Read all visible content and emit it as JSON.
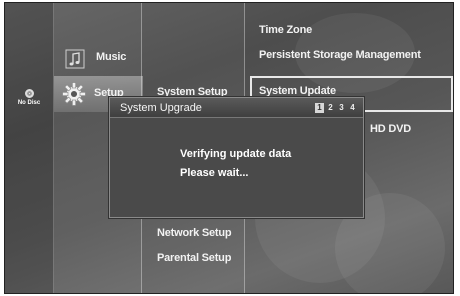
{
  "status": {
    "disc_label": "No Disc"
  },
  "categories": [
    {
      "label": "Music",
      "icon": "music-note-icon",
      "active": false
    },
    {
      "label": "Setup",
      "icon": "gear-icon",
      "active": true
    }
  ],
  "submenu": {
    "top": "System Setup",
    "bottom": [
      "Network Setup",
      "Parental Setup"
    ]
  },
  "options": {
    "items": [
      "Time Zone",
      "Persistent Storage Management",
      "System Update"
    ],
    "selected": "System Update",
    "partial_visible": "HD DVD"
  },
  "dialog": {
    "title": "System Upgrade",
    "steps": [
      "1",
      "2",
      "3",
      "4"
    ],
    "current_step": "1",
    "line1": "Verifying update data",
    "line2": "Please wait..."
  },
  "colors": {
    "background": "#555555",
    "text": "#f2f2f2",
    "dialog": "#4a4a4a",
    "highlight": "#e8e8e8"
  }
}
